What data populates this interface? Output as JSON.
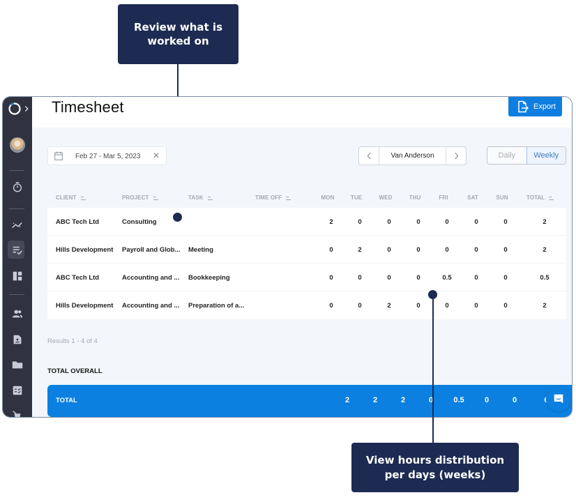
{
  "callouts": {
    "top": "Review what is worked on",
    "bottom": "View hours distribution per days (weeks)"
  },
  "header": {
    "title": "Timesheet",
    "export_label": "Export"
  },
  "sidebar": {
    "items": [
      {
        "name": "logo",
        "icon": "logo-ring-icon"
      },
      {
        "name": "expand",
        "icon": "chevron-right-icon"
      },
      {
        "name": "profile",
        "icon": "avatar"
      },
      {
        "name": "timer",
        "icon": "stopwatch-icon"
      },
      {
        "name": "reports",
        "icon": "trend-chart-icon"
      },
      {
        "name": "timesheet",
        "icon": "list-check-icon",
        "active": true
      },
      {
        "name": "dashboard",
        "icon": "layout-icon"
      },
      {
        "name": "team",
        "icon": "people-icon"
      },
      {
        "name": "clients",
        "icon": "contact-file-icon"
      },
      {
        "name": "projects",
        "icon": "folder-icon"
      },
      {
        "name": "tasks",
        "icon": "checklist-icon"
      },
      {
        "name": "time-off",
        "icon": "time-off-icon"
      }
    ]
  },
  "filters": {
    "date_range": "Feb 27 - Mar 5, 2023",
    "user": "Van Anderson",
    "views": [
      "Daily",
      "Weekly"
    ],
    "active_view": "Weekly"
  },
  "table": {
    "columns": {
      "client": "CLIENT",
      "project": "PROJECT",
      "task": "TASK",
      "time_off": "TIME OFF",
      "days": [
        "MON",
        "TUE",
        "WED",
        "THU",
        "FRI",
        "SAT",
        "SUN"
      ],
      "total": "TOTAL"
    },
    "rows": [
      {
        "client": "ABC Tech Ltd",
        "project": "Consulting",
        "task": "",
        "time_off": "",
        "days": [
          "2",
          "0",
          "0",
          "0",
          "0",
          "0",
          "0"
        ],
        "total": "2"
      },
      {
        "client": "Hills Development",
        "project": "Payroll and Glob...",
        "task": "Meeting",
        "time_off": "",
        "days": [
          "0",
          "2",
          "0",
          "0",
          "0",
          "0",
          "0"
        ],
        "total": "2"
      },
      {
        "client": "ABC Tech Ltd",
        "project": "Accounting and ...",
        "task": "Bookkeeping",
        "time_off": "",
        "days": [
          "0",
          "0",
          "0",
          "0",
          "0.5",
          "0",
          "0"
        ],
        "total": "0.5"
      },
      {
        "client": "Hills Development",
        "project": "Accounting and ...",
        "task": "Preparation of a...",
        "time_off": "",
        "days": [
          "0",
          "0",
          "2",
          "0",
          "0",
          "0",
          "0"
        ],
        "total": "2"
      }
    ],
    "results_text": "Results 1 - 4 of 4"
  },
  "totals": {
    "section_label": "TOTAL OVERALL",
    "row_label": "TOTAL",
    "days": [
      "2",
      "2",
      "2",
      "0",
      "0.5",
      "0",
      "0"
    ],
    "total": "6.5"
  },
  "colors": {
    "primary": "#0b80e0",
    "sidebar": "#30333f",
    "callout": "#1d2b52"
  }
}
